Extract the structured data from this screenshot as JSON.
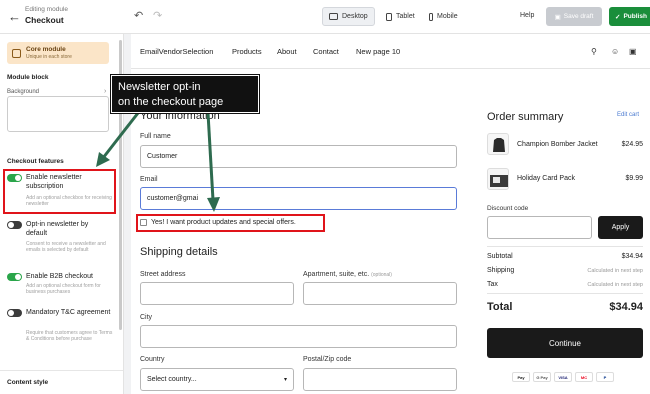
{
  "topbar": {
    "editing_sub": "Editing module",
    "editing_title": "Checkout",
    "devices": [
      {
        "label": "Desktop",
        "active": true
      },
      {
        "label": "Tablet",
        "active": false
      },
      {
        "label": "Mobile",
        "active": false
      }
    ],
    "help": "Help",
    "save_draft": "Save draft",
    "publish": "Publish"
  },
  "sidebar": {
    "core_module_title": "Core module",
    "core_module_sub": "Unique in each store",
    "module_block_heading": "Module block",
    "background_label": "Background",
    "checkout_features_heading": "Checkout features",
    "features": [
      {
        "title": "Enable newsletter subscription",
        "desc": "Add an optional checkbox for receiving newsletter",
        "on": true
      },
      {
        "title": "Opt-in newsletter by default",
        "desc": "Consent to receive a newsletter and emails is selected by default",
        "on": false
      },
      {
        "title": "Enable B2B checkout",
        "desc": "Add an optional checkout form for business purchases",
        "on": true
      },
      {
        "title": "Mandatory T&C agreement",
        "desc": "Require that customers agree to Terms & Conditions before purchase",
        "on": false
      }
    ],
    "content_style_heading": "Content style"
  },
  "store": {
    "name": "EmailVendorSelection",
    "nav": [
      "Products",
      "About",
      "Contact",
      "New page 10"
    ]
  },
  "checkout": {
    "your_information_title": "Your information",
    "full_name_label": "Full name",
    "full_name_value": "Customer",
    "email_label": "Email",
    "email_value": "customer@gmai",
    "optin_label": "Yes! I want product updates and special offers.",
    "shipping_title": "Shipping details",
    "street_label": "Street address",
    "apartment_label": "Apartment, suite, etc.",
    "optional_tag": "(optional)",
    "city_label": "City",
    "country_label": "Country",
    "country_placeholder": "Select country...",
    "postal_label": "Postal/Zip code"
  },
  "summary": {
    "title": "Order summary",
    "edit_cart": "Edit cart",
    "items": [
      {
        "name": "Champion Bomber Jacket",
        "price": "$24.95"
      },
      {
        "name": "Holiday Card Pack",
        "price": "$9.99"
      }
    ],
    "discount_label": "Discount code",
    "apply": "Apply",
    "subtotal_label": "Subtotal",
    "subtotal_value": "$34.94",
    "shipping_label": "Shipping",
    "shipping_value": "Calculated in next step",
    "tax_label": "Tax",
    "tax_value": "Calculated in next step",
    "total_label": "Total",
    "total_value": "$34.94",
    "continue": "Continue",
    "payments": [
      "Pay",
      "G Pay",
      "VISA",
      "MC",
      "P"
    ]
  },
  "annotation": {
    "callout_line1": "Newsletter opt-in",
    "callout_line2": "on the checkout page",
    "highlight_color": "#e0141a",
    "arrow_color": "#2e6b4f"
  }
}
